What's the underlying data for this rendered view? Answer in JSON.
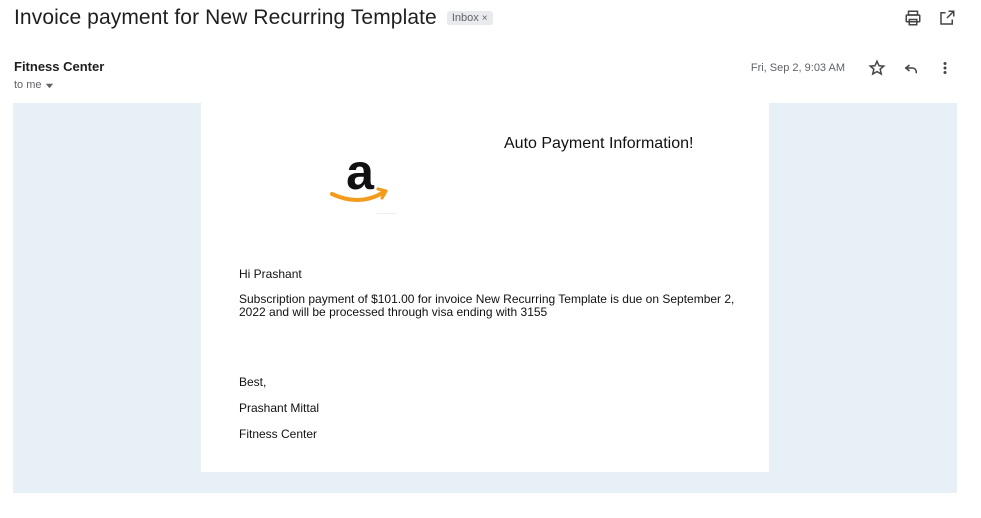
{
  "email": {
    "subject": "Invoice payment for New Recurring Template",
    "label": "Inbox",
    "label_close": "×",
    "sender": "Fitness Center",
    "recipient": "to me",
    "date": "Fri, Sep 2, 9:03 AM"
  },
  "icons": {
    "print": "print-icon",
    "open_new": "open-in-new-icon",
    "star": "star-icon",
    "reply": "reply-icon",
    "more": "more-vert-icon",
    "dropdown": "dropdown-icon",
    "logo": "amazon-logo"
  },
  "message": {
    "heading": "Auto Payment Information!",
    "greeting": "Hi Prashant",
    "paragraph": "Subscription payment of $101.00 for invoice New Recurring Template is due on September 2, 2022 and will be processed through visa ending with 3155",
    "closing": "Best,",
    "signature_name": "Prashant Mittal",
    "signature_org": "Fitness Center"
  },
  "colors": {
    "outer_background": "#e8f0f7",
    "logo_orange": "#f29b1d",
    "logo_black": "#111111"
  }
}
